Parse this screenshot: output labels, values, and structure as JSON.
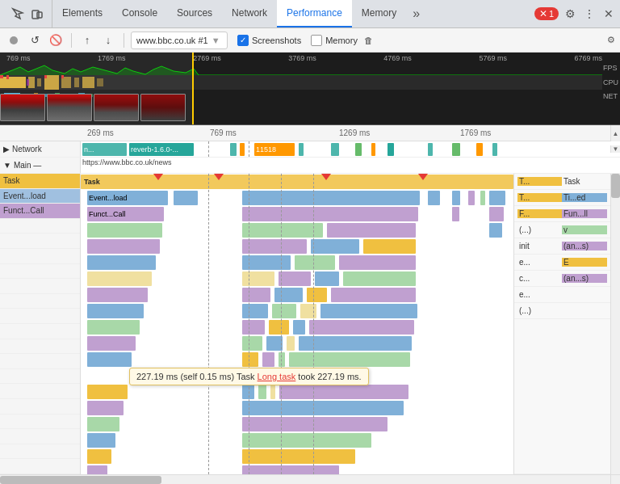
{
  "tabs": {
    "items": [
      {
        "label": "Elements",
        "active": false
      },
      {
        "label": "Console",
        "active": false
      },
      {
        "label": "Sources",
        "active": false
      },
      {
        "label": "Network",
        "active": false
      },
      {
        "label": "Performance",
        "active": true
      },
      {
        "label": "Memory",
        "active": false
      }
    ],
    "overflow_label": "»"
  },
  "toolbar": {
    "url": "www.bbc.co.uk #1",
    "screenshots_label": "Screenshots",
    "memory_label": "Memory",
    "screenshots_checked": true,
    "memory_checked": false
  },
  "sub_tabs": {
    "items": [
      {
        "label": "Memory",
        "active": true
      }
    ]
  },
  "timeline": {
    "timestamps_top": [
      "769 ms",
      "1769 ms",
      "2769 ms",
      "3769 ms",
      "4769 ms",
      "5769 ms",
      "6769 ms"
    ],
    "side_labels": [
      "FPS",
      "CPU",
      "NET"
    ],
    "timestamps_mid": [
      "269 ms",
      "769 ms",
      "1269 ms",
      "1769 ms"
    ]
  },
  "flame_rows": [
    {
      "label": "▶ Network",
      "sublabel": "n... reverb-1.6.0-..."
    },
    {
      "label": "▼ Main —",
      "sublabel": "https://www.bbc.co.uk/news"
    }
  ],
  "call_labels": [
    {
      "label": "Task",
      "color": "yellow"
    },
    {
      "label": "Event...load",
      "color": "blue"
    },
    {
      "label": "Funct...Call",
      "color": "purple"
    }
  ],
  "right_panel": [
    {
      "col1": "T...",
      "col2": "Task",
      "c1bg": "yellow",
      "c2bg": ""
    },
    {
      "col1": "T...",
      "col2": "Ti...ed",
      "c1bg": "yellow",
      "c2bg": "blue"
    },
    {
      "col1": "F...",
      "col2": "Fun...ll",
      "c1bg": "yellow",
      "c2bg": "purple"
    },
    {
      "col1": "(...)",
      "col2": "v",
      "c1bg": "",
      "c2bg": ""
    },
    {
      "col1": "init",
      "col2": "(an...s)",
      "c1bg": "",
      "c2bg": ""
    },
    {
      "col1": "e...",
      "col2": "E",
      "c1bg": "",
      "c2bg": ""
    },
    {
      "col1": "c...",
      "col2": "(an...s)",
      "c1bg": "",
      "c2bg": ""
    },
    {
      "col1": "e...",
      "col2": "",
      "c1bg": "",
      "c2bg": ""
    },
    {
      "col1": "(...)",
      "col2": "",
      "c1bg": "",
      "c2bg": ""
    }
  ],
  "tooltip": {
    "text": "227.19 ms (self 0.15 ms)  Task ",
    "link": "Long task",
    "text2": " took 227.19 ms."
  },
  "task_row_label": "Task",
  "network_block_label": "11518",
  "error_count": "1",
  "colors": {
    "accent": "#1a73e8",
    "error": "#e53935",
    "yellow": "#f0c040",
    "blue_light": "#a8c8e8",
    "purple": "#c8a0d8",
    "green": "#4caf50",
    "orange": "#ff9800"
  }
}
